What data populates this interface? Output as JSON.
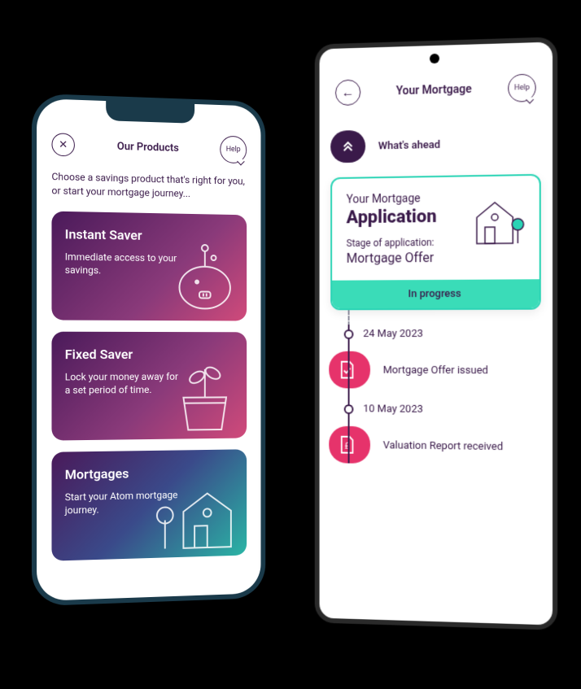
{
  "phone1": {
    "title": "Our Products",
    "help_label": "Help",
    "intro": "Choose a savings product that's right for you, or start your mortgage journey...",
    "products": [
      {
        "title": "Instant Saver",
        "desc": "Immediate access to your savings."
      },
      {
        "title": "Fixed Saver",
        "desc": "Lock your money away for a set period of time."
      },
      {
        "title": "Mortgages",
        "desc": "Start your Atom mortgage journey."
      }
    ]
  },
  "phone2": {
    "title": "Your Mortgage",
    "help_label": "Help",
    "whats_ahead": "What's ahead",
    "application_card": {
      "eyebrow": "Your Mortgage",
      "title": "Application",
      "stage_label": "Stage of application:",
      "stage": "Mortgage Offer",
      "status": "In progress"
    },
    "timeline": [
      {
        "type": "date",
        "text": "24 May 2023"
      },
      {
        "type": "event",
        "text": "Mortgage Offer issued"
      },
      {
        "type": "date",
        "text": "10 May 2023"
      },
      {
        "type": "event",
        "text": "Valuation Report received"
      }
    ]
  }
}
